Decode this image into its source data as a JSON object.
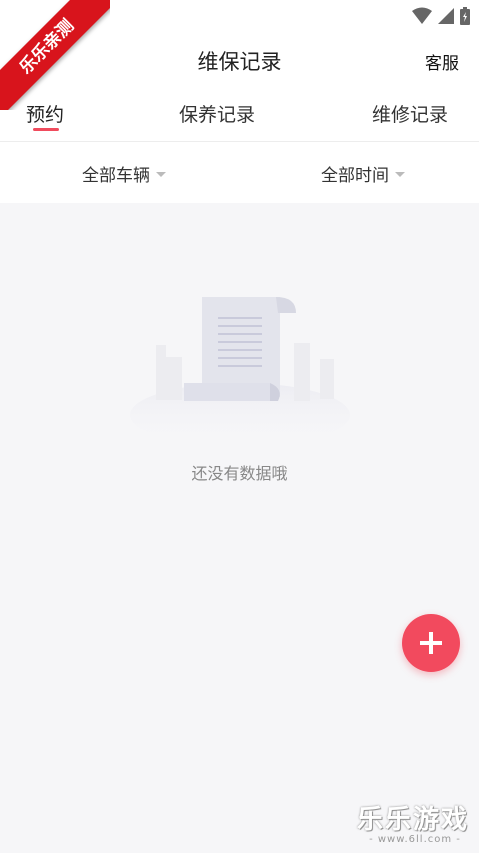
{
  "header": {
    "title": "维保记录",
    "service_label": "客服"
  },
  "tabs": [
    {
      "label": "预约",
      "active": true
    },
    {
      "label": "保养记录",
      "active": false
    },
    {
      "label": "维修记录",
      "active": false
    }
  ],
  "filters": {
    "vehicle": "全部车辆",
    "time": "全部时间"
  },
  "empty_state": {
    "message": "还没有数据哦"
  },
  "overlay": {
    "ribbon_text": "乐乐亲测",
    "watermark_text": "乐乐游戏",
    "watermark_sub": "- www.6ll.com -"
  },
  "colors": {
    "accent": "#f24a5e",
    "background": "#f6f6f8",
    "ribbon": "#d8141c"
  }
}
